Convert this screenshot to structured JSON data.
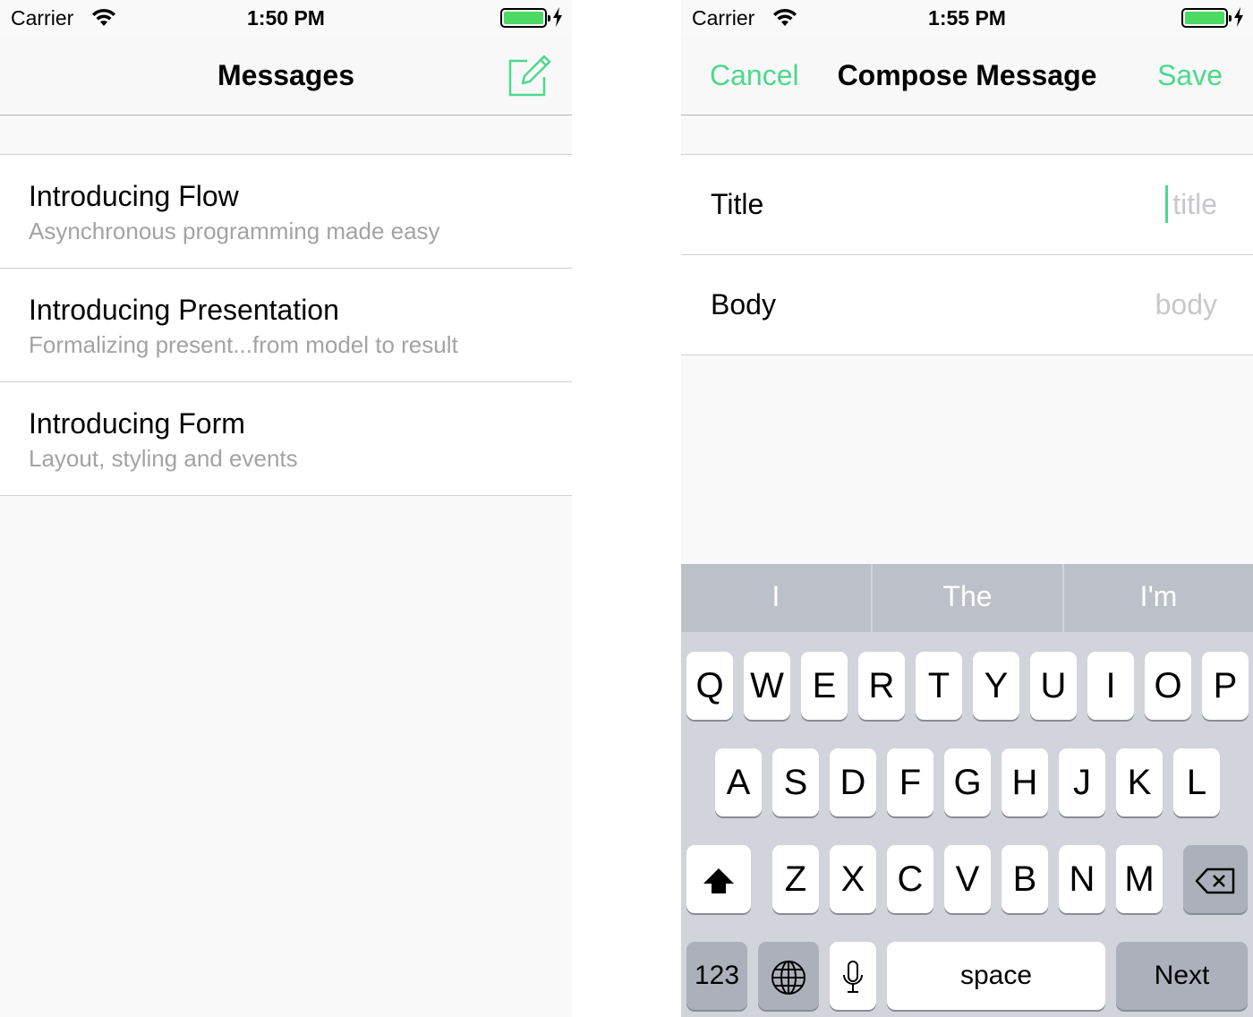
{
  "left_screen": {
    "status": {
      "carrier": "Carrier",
      "time": "1:50 PM"
    },
    "nav": {
      "title": "Messages",
      "compose_icon": "compose-icon"
    },
    "messages": [
      {
        "title": "Introducing Flow",
        "subtitle": "Asynchronous programming made easy"
      },
      {
        "title": "Introducing Presentation",
        "subtitle": "Formalizing present...from model to result"
      },
      {
        "title": "Introducing Form",
        "subtitle": "Layout, styling and events"
      }
    ]
  },
  "right_screen": {
    "status": {
      "carrier": "Carrier",
      "time": "1:55 PM"
    },
    "nav": {
      "cancel": "Cancel",
      "title": "Compose Message",
      "save": "Save"
    },
    "form": {
      "title_label": "Title",
      "title_placeholder": "title",
      "body_label": "Body",
      "body_placeholder": "body"
    },
    "keyboard": {
      "suggestions": [
        "I",
        "The",
        "I'm"
      ],
      "row1": [
        "Q",
        "W",
        "E",
        "R",
        "T",
        "Y",
        "U",
        "I",
        "O",
        "P"
      ],
      "row2": [
        "A",
        "S",
        "D",
        "F",
        "G",
        "H",
        "J",
        "K",
        "L"
      ],
      "row3": [
        "Z",
        "X",
        "C",
        "V",
        "B",
        "N",
        "M"
      ],
      "numbers_key": "123",
      "space_key": "space",
      "return_key": "Next"
    }
  },
  "colors": {
    "accent": "#4cd98c",
    "battery": "#4cd964",
    "subtitle": "#a3a3a3",
    "placeholder": "#c7c7cd"
  }
}
